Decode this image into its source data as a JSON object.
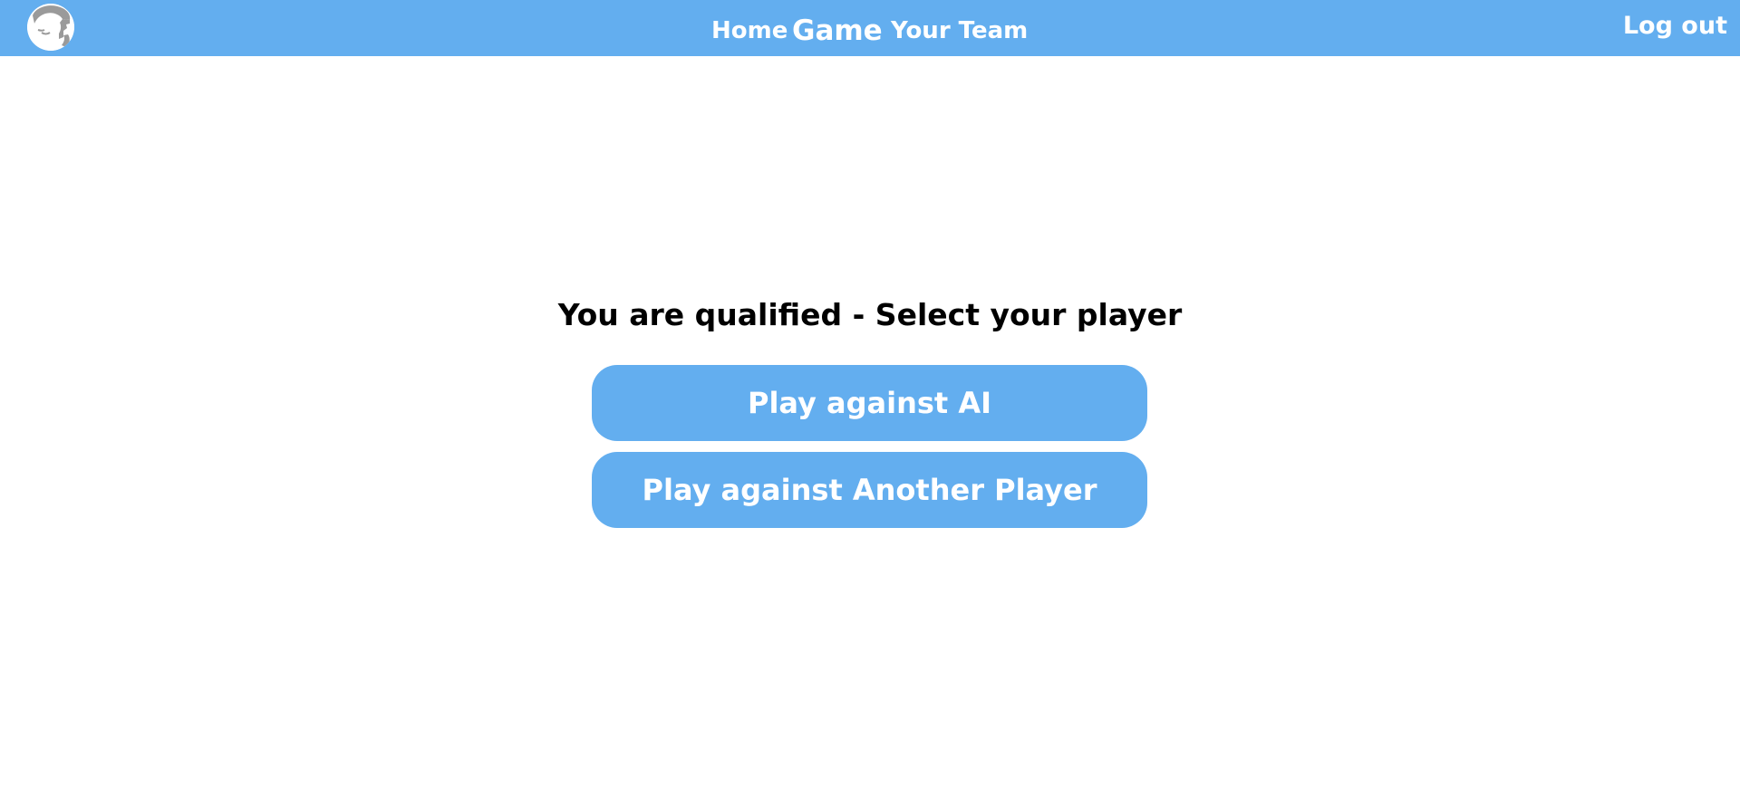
{
  "navbar": {
    "logo_icon": "avatar-logo-icon",
    "links": [
      {
        "label": "Home"
      },
      {
        "label": "Game"
      },
      {
        "label": "Your Team"
      }
    ],
    "logout_label": "Log out"
  },
  "main": {
    "title": "You are qualified - Select your player",
    "buttons": [
      {
        "label": "Play against AI"
      },
      {
        "label": "Play against Another Player"
      }
    ]
  },
  "colors": {
    "accent": "#63aeef",
    "background": "#ffffff",
    "text_dark": "#000000",
    "text_light": "#ffffff",
    "logo_gray": "#9a9a9a"
  }
}
